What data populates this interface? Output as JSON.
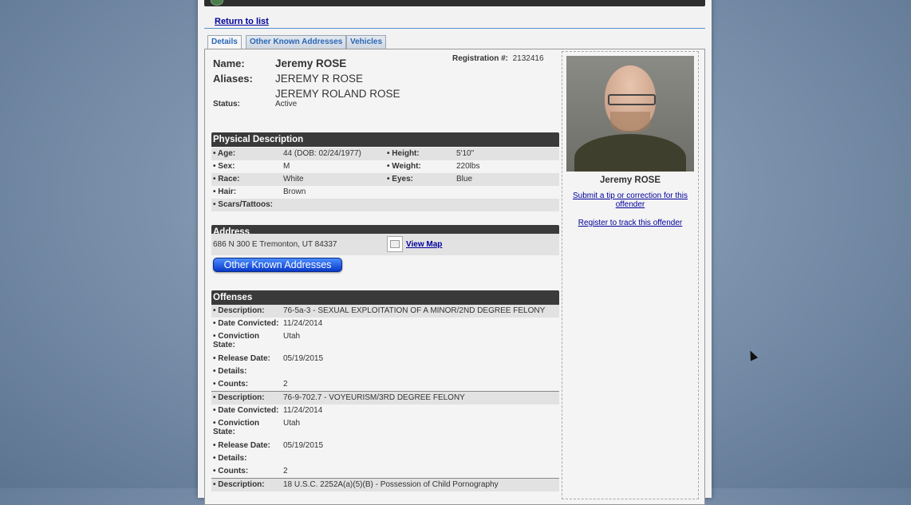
{
  "nav": {
    "return_label": "Return to list"
  },
  "tabs": [
    {
      "label": "Details",
      "active": true
    },
    {
      "label": "Other Known Addresses",
      "active": false
    },
    {
      "label": "Vehicles",
      "active": false
    }
  ],
  "offender": {
    "name_label": "Name:",
    "name": "Jeremy ROSE",
    "aliases_label": "Aliases:",
    "aliases": [
      "JEREMY R ROSE",
      "JEREMY ROLAND ROSE"
    ],
    "registration_label": "Registration #:",
    "registration_number": "2132416",
    "status_label": "Status:",
    "status": "Active"
  },
  "physical": {
    "title": "Physical Description",
    "age_label": "• Age:",
    "age": "44  (DOB: 02/24/1977)",
    "height_label": "• Height:",
    "height": "5'10\"",
    "sex_label": "• Sex:",
    "sex": "M",
    "weight_label": "• Weight:",
    "weight": "220lbs",
    "race_label": "• Race:",
    "race": "White",
    "eyes_label": "• Eyes:",
    "eyes": "Blue",
    "hair_label": "• Hair:",
    "hair": "Brown",
    "scars_label": "• Scars/Tattoos:",
    "scars": ""
  },
  "address": {
    "title": "Address",
    "line": "686 N 300 E Tremonton, UT 84337",
    "view_map": "View Map",
    "other_addresses_button": "Other Known Addresses"
  },
  "offenses": {
    "title": "Offenses",
    "labels": {
      "description": "• Description:",
      "date_convicted": "• Date Convicted:",
      "conviction_state": "• Conviction State:",
      "release_date": "• Release Date:",
      "details": "• Details:",
      "counts": "• Counts:"
    },
    "items": [
      {
        "description": "76-5a-3 - SEXUAL EXPLOITATION OF A MINOR/2ND DEGREE FELONY",
        "date_convicted": "11/24/2014",
        "conviction_state": "Utah",
        "release_date": "05/19/2015",
        "details": "",
        "counts": "2"
      },
      {
        "description": "76-9-702.7 - VOYEURISM/3RD DEGREE FELONY",
        "date_convicted": "11/24/2014",
        "conviction_state": "Utah",
        "release_date": "05/19/2015",
        "details": "",
        "counts": "2"
      },
      {
        "description": "18 U.S.C. 2252A(a)(5)(B) - Possession of Child Pornography"
      }
    ]
  },
  "sidebar": {
    "photo_name": "Jeremy ROSE",
    "tip_link": "Submit a tip or correction for this offender",
    "register_link": "Register to track this offender"
  },
  "colors": {
    "link": "#00009c",
    "section_header": "#3a3a3a",
    "tab_text": "#2a66b8",
    "button": "#0a3ac8"
  }
}
